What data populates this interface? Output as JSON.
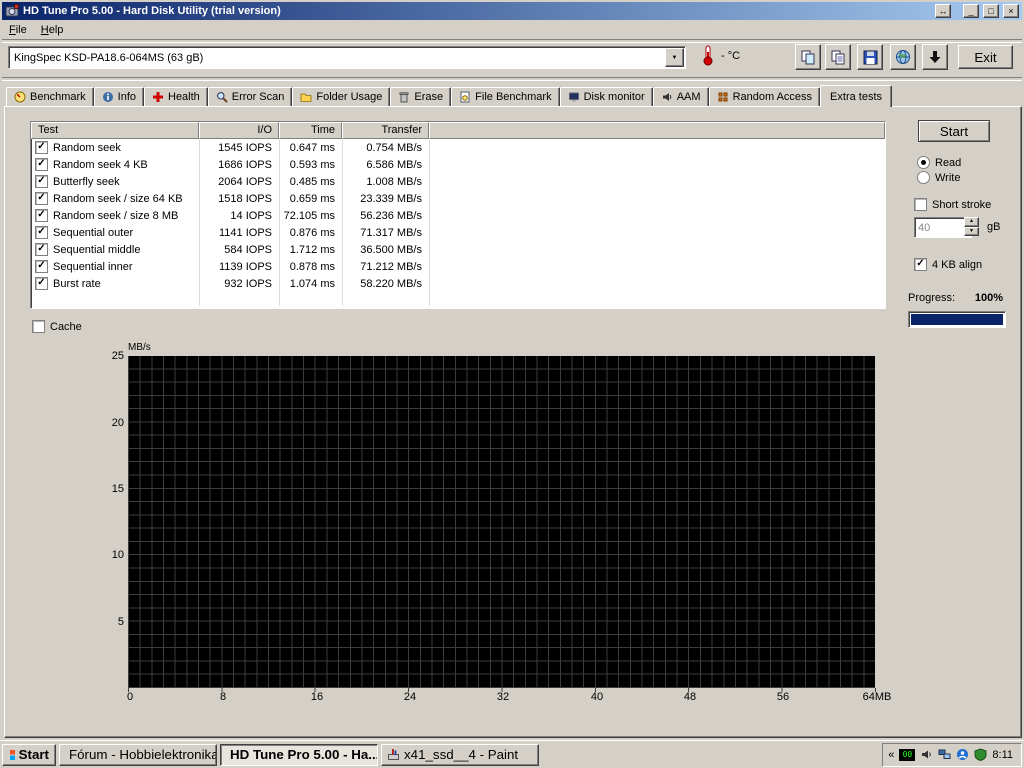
{
  "window": {
    "title": "HD Tune Pro 5.00 - Hard Disk Utility (trial version)"
  },
  "icons": {
    "rollup": "↔",
    "minimize": "_",
    "maximize": "□",
    "close": "×",
    "dropdown": "▼",
    "spin_up": "▲",
    "spin_down": "▼",
    "chevron": "«"
  },
  "menu": [
    "File",
    "Help"
  ],
  "toolbar": {
    "drive_selector": "KingSpec KSD-PA18.6-064MS (63 gB)",
    "temperature": "- °C",
    "exit": "Exit"
  },
  "tabs": [
    "Benchmark",
    "Info",
    "Health",
    "Error Scan",
    "Folder Usage",
    "Erase",
    "File Benchmark",
    "Disk monitor",
    "AAM",
    "Random Access",
    "Extra tests"
  ],
  "active_tab": "Extra tests",
  "extra_tests": {
    "table": {
      "headers": [
        "Test",
        "I/O",
        "Time",
        "Transfer"
      ],
      "rows": [
        {
          "checked": true,
          "test": "Random seek",
          "io": "1545 IOPS",
          "time": "0.647 ms",
          "transfer": "0.754 MB/s"
        },
        {
          "checked": true,
          "test": "Random seek 4 KB",
          "io": "1686 IOPS",
          "time": "0.593 ms",
          "transfer": "6.586 MB/s"
        },
        {
          "checked": true,
          "test": "Butterfly seek",
          "io": "2064 IOPS",
          "time": "0.485 ms",
          "transfer": "1.008 MB/s"
        },
        {
          "checked": true,
          "test": "Random seek / size 64 KB",
          "io": "1518 IOPS",
          "time": "0.659 ms",
          "transfer": "23.339 MB/s"
        },
        {
          "checked": true,
          "test": "Random seek / size 8 MB",
          "io": "14 IOPS",
          "time": "72.105 ms",
          "transfer": "56.236 MB/s"
        },
        {
          "checked": true,
          "test": "Sequential outer",
          "io": "1141 IOPS",
          "time": "0.876 ms",
          "transfer": "71.317 MB/s"
        },
        {
          "checked": true,
          "test": "Sequential middle",
          "io": "584 IOPS",
          "time": "1.712 ms",
          "transfer": "36.500 MB/s"
        },
        {
          "checked": true,
          "test": "Sequential inner",
          "io": "1139 IOPS",
          "time": "0.878 ms",
          "transfer": "71.212 MB/s"
        },
        {
          "checked": true,
          "test": "Burst rate",
          "io": "932 IOPS",
          "time": "1.074 ms",
          "transfer": "58.220 MB/s"
        }
      ]
    },
    "cache_label": "Cache",
    "controls": {
      "start": "Start",
      "read": "Read",
      "write": "Write",
      "short_stroke": "Short stroke",
      "short_stroke_value": "40",
      "unit": "gB",
      "align": "4 KB align",
      "progress_label": "Progress:",
      "progress_value": "100%"
    }
  },
  "chart_data": {
    "type": "line",
    "title": "",
    "ylabel": "MB/s",
    "ylim": [
      0,
      25
    ],
    "xlim_mb": [
      0,
      64
    ],
    "yticks": [
      "25",
      "20",
      "15",
      "10",
      "5"
    ],
    "xticks": [
      "0",
      "8",
      "16",
      "24",
      "32",
      "40",
      "48",
      "56",
      "64MB"
    ],
    "grid": true,
    "series": []
  },
  "taskbar": {
    "start": "Start",
    "tasks": [
      {
        "label": "Fórum - Hobbielektronika...",
        "active": false
      },
      {
        "label": "HD Tune Pro 5.00 - Ha...",
        "active": true
      },
      {
        "label": "x41_ssd__4 - Paint",
        "active": false
      }
    ],
    "tray_meter": "00",
    "clock": "8:11"
  }
}
